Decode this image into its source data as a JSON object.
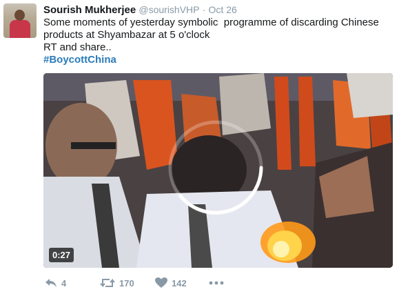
{
  "tweet": {
    "author_name": "Sourish Mukherjee",
    "author_handle": "@sourishVHP",
    "separator": "·",
    "time": "Oct 26",
    "text_lines": [
      "Some moments of yesterday symbolic  programme of discarding Chinese",
      "products at Shyambazar at 5 o'clock",
      "RT and share.."
    ],
    "hashtag": "#BoycottChina"
  },
  "media": {
    "duration": "0:27"
  },
  "actions": {
    "reply_count": "4",
    "retweet_count": "170",
    "like_count": "142"
  },
  "icons": {
    "reply": "reply-icon",
    "retweet": "retweet-icon",
    "like": "heart-icon",
    "more": "more-icon"
  },
  "colors": {
    "hashtag": "#2b7bb9",
    "meta_gray": "#8899a6"
  }
}
